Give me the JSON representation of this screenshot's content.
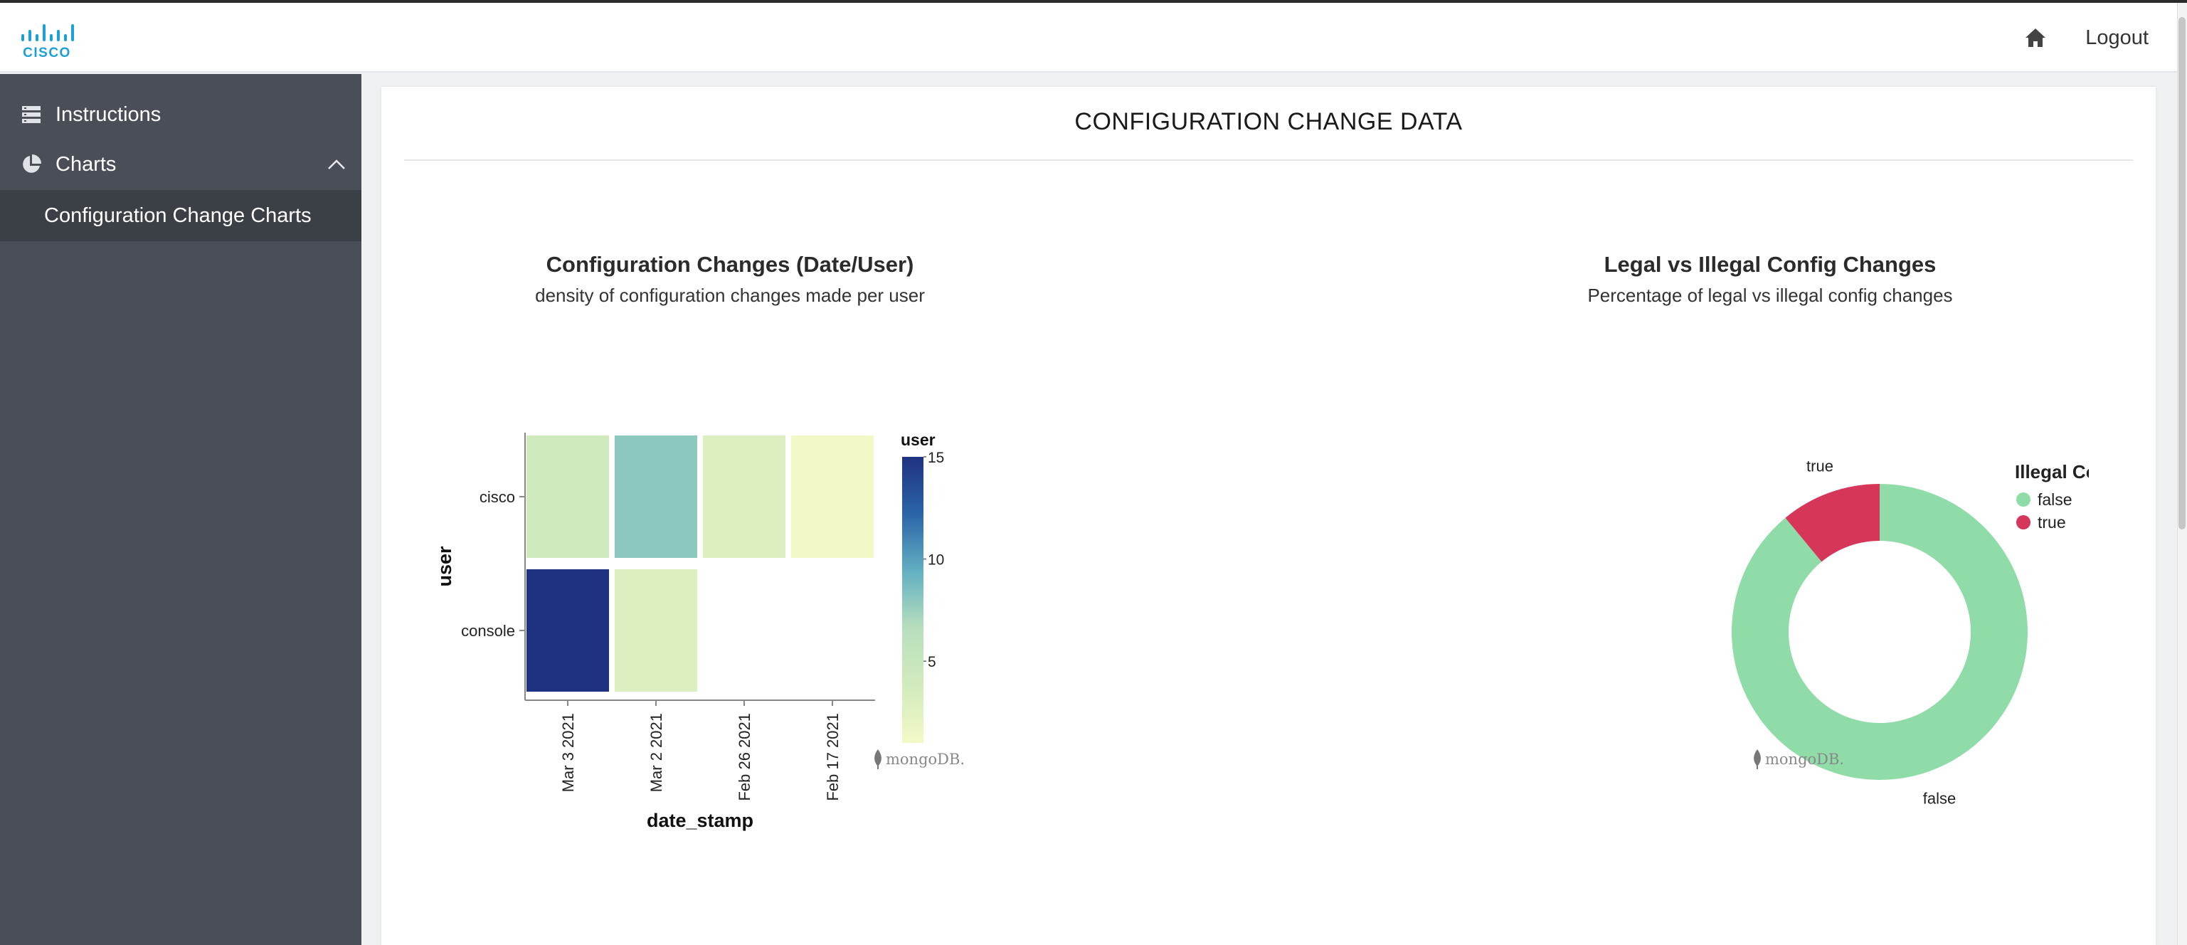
{
  "header": {
    "brand": "CISCO",
    "logout_label": "Logout"
  },
  "icons": {
    "logo": "cisco-logo",
    "home": "home-icon",
    "instructions": "server-list-icon",
    "charts": "pie-chart-icon",
    "charts_toggle": "chevron-up-icon",
    "watermark": "mongodb-leaf-icon"
  },
  "sidebar": {
    "items": [
      {
        "label": "Instructions"
      },
      {
        "label": "Charts"
      }
    ],
    "sub_items": [
      {
        "label": "Configuration Change Charts"
      }
    ]
  },
  "main": {
    "title": "CONFIGURATION CHANGE DATA",
    "watermark": "mongoDB."
  },
  "colors": {
    "accent_cisco": "#1ba0d7",
    "sidebar_bg": "#4a4f57",
    "sidebar_active": "#3b3f46",
    "legal_false": "#8fdca8",
    "legal_true": "#d6365a"
  },
  "chart_data": [
    {
      "type": "heatmap",
      "title": "Configuration Changes (Date/User)",
      "subtitle": "density of configuration changes made per user",
      "xlabel": "date_stamp",
      "ylabel": "user",
      "x_categories": [
        "Mar  3 2021",
        "Mar  2 2021",
        "Feb 26 2021",
        "Feb 17 2021"
      ],
      "y_categories": [
        "cisco",
        "console"
      ],
      "cells": [
        {
          "x": "Mar  3 2021",
          "y": "cisco",
          "value": 4
        },
        {
          "x": "Mar  2 2021",
          "y": "cisco",
          "value": 8
        },
        {
          "x": "Feb 26 2021",
          "y": "cisco",
          "value": 3
        },
        {
          "x": "Feb 17 2021",
          "y": "cisco",
          "value": 1
        },
        {
          "x": "Mar  3 2021",
          "y": "console",
          "value": 15
        },
        {
          "x": "Mar  2 2021",
          "y": "console",
          "value": 3
        }
      ],
      "color_scale": {
        "title": "user",
        "domain": [
          1,
          15
        ],
        "ticks": [
          5,
          10,
          15
        ],
        "colors": [
          "#f3f9c6",
          "#d2ebbd",
          "#b8dfbd",
          "#62b0c2",
          "#2b64a8",
          "#1f3282"
        ]
      }
    },
    {
      "type": "pie",
      "donut": true,
      "title": "Legal vs Illegal Config Changes",
      "subtitle": "Percentage of legal vs illegal config changes",
      "legend_title": "Illegal Config Change",
      "legend_position": "right",
      "slices": [
        {
          "label": "false",
          "value": 89,
          "color": "#8fdca8"
        },
        {
          "label": "true",
          "value": 11,
          "color": "#d6365a"
        }
      ]
    }
  ]
}
